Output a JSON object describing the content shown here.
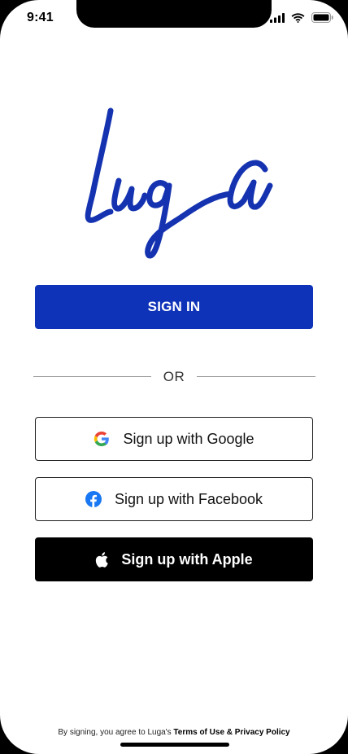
{
  "status_bar": {
    "time": "9:41",
    "icons": [
      "signal-icon",
      "wifi-icon",
      "battery-icon"
    ]
  },
  "logo": {
    "text": "Luga",
    "color": "#1533b0"
  },
  "sign_in": {
    "label": "SIGN IN",
    "color": "#0f33b8"
  },
  "divider": {
    "label": "OR"
  },
  "social": {
    "google_label": "Sign up with Google",
    "facebook_label": "Sign up with Facebook",
    "apple_label": "Sign up with Apple"
  },
  "legal": {
    "prefix": "By signing, you agree to Luga's ",
    "terms": "Terms of Use",
    "ampersand": " & ",
    "privacy": "Privacy Policy"
  }
}
